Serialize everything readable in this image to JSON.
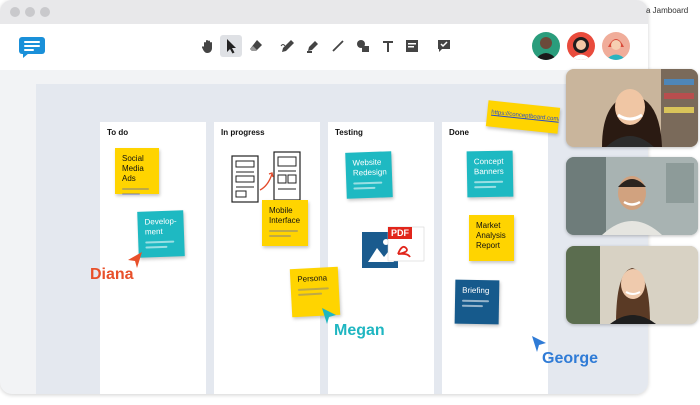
{
  "window": {
    "tab_title": "a Jamboard"
  },
  "toolbar": {
    "tools": [
      "hand-icon",
      "pointer-icon",
      "eraser-icon",
      "pen-icon",
      "highlighter-icon",
      "line-icon",
      "shapes-icon",
      "text-icon",
      "sticky-note-icon",
      "comment-icon"
    ],
    "active_tool": "pointer-icon"
  },
  "board": {
    "columns": [
      {
        "title": "To do"
      },
      {
        "title": "In progress"
      },
      {
        "title": "Testing"
      },
      {
        "title": "Done"
      }
    ],
    "notes": {
      "social_media_ads": "Social Media Ads",
      "development": "Develop-ment",
      "mobile_interface": "Mobile Interface",
      "persona": "Persona",
      "website_redesign": "Website Redesign",
      "concept_banners": "Concept Banners",
      "market_analysis": "Market Analysis Report",
      "briefing": "Briefing",
      "link_note": "https://conceptboard.com/"
    },
    "pdf_label": "PDF",
    "cursors": [
      {
        "name": "Diana",
        "color": "#e8502a"
      },
      {
        "name": "Megan",
        "color": "#1fb6c1"
      },
      {
        "name": "George",
        "color": "#2f7bd6"
      }
    ]
  },
  "colors": {
    "sticky_yellow": "#ffd400",
    "sticky_teal": "#1eb9c2",
    "sticky_navy": "#165a8c"
  }
}
